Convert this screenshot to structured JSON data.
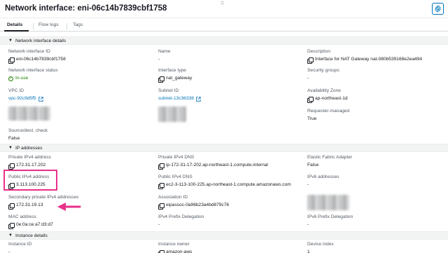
{
  "header": {
    "title": "Network interface: eni-06c14b7839cbf1758",
    "drag_glyph": "=",
    "settings_icon": "gear-icon"
  },
  "tabs": [
    {
      "label": "Details",
      "active": true
    },
    {
      "label": "Flow logs",
      "active": false
    },
    {
      "label": "Tags",
      "active": false
    }
  ],
  "sections": {
    "details": "Network interface details",
    "ip": "IP addresses",
    "instance": "Instance details"
  },
  "details": {
    "eni_id": {
      "label": "Network interface ID",
      "value": "eni-06c14b7839cbf1758"
    },
    "name": {
      "label": "Name",
      "value": "-"
    },
    "description": {
      "label": "Description",
      "value": "Interface for NAT Gateway nat-080b539168e2ea494"
    },
    "status": {
      "label": "Network interface status",
      "value": "In-use"
    },
    "type": {
      "label": "Interface type",
      "value": "nat_gateway"
    },
    "security_groups": {
      "label": "Security groups",
      "value": "-"
    },
    "vpc": {
      "label": "VPC ID",
      "value": "vpc-92c9d5f5"
    },
    "subnet": {
      "label": "Subnet ID",
      "value": "subnet-13c36338"
    },
    "az": {
      "label": "Availability Zone",
      "value": "ap-northeast-1d"
    },
    "requester": {
      "label": "Requester-managed",
      "value": "True"
    },
    "source_dest": {
      "label": "Source/dest. check",
      "value": "False"
    }
  },
  "ip": {
    "private_ipv4": {
      "label": "Private IPv4 address",
      "value": "172.31.17.202"
    },
    "private_dns": {
      "label": "Private IPv4 DNS",
      "value": "ip-172-31-17-202.ap-northeast-1.compute.internal"
    },
    "efa": {
      "label": "Elastic Fabric Adapter",
      "value": "False"
    },
    "public_ipv4": {
      "label": "Public IPv4 address",
      "value": "3.113.100.225"
    },
    "public_dns": {
      "label": "Public IPv4 DNS",
      "value": "ec2-3-113-100-225.ap-northeast-1.compute.amazonaws.com"
    },
    "ipv6": {
      "label": "IPv6 addresses",
      "value": "-"
    },
    "secondary": {
      "label": "Secondary private IPv4 addresses",
      "value": "172.31.19.13"
    },
    "association": {
      "label": "Association ID",
      "value": "eipassoc-0a96b23a4bd879c76"
    },
    "mac": {
      "label": "MAC address",
      "value": "0e:0a:ce:a7:d3:d7"
    },
    "ipv4_prefix": {
      "label": "IPv4 Prefix Delegation",
      "value": "-"
    },
    "ipv6_prefix": {
      "label": "IPv6 Prefix Delegation",
      "value": "-"
    }
  },
  "instance": {
    "instance_id": {
      "label": "Instance ID",
      "value": "-"
    },
    "owner": {
      "label": "Instance owner",
      "value": "amazon-aws"
    },
    "device_index": {
      "label": "Device index",
      "value": "1"
    }
  },
  "colors": {
    "link": "#0073bb",
    "success": "#1d8102",
    "highlight": "#e8308a"
  }
}
